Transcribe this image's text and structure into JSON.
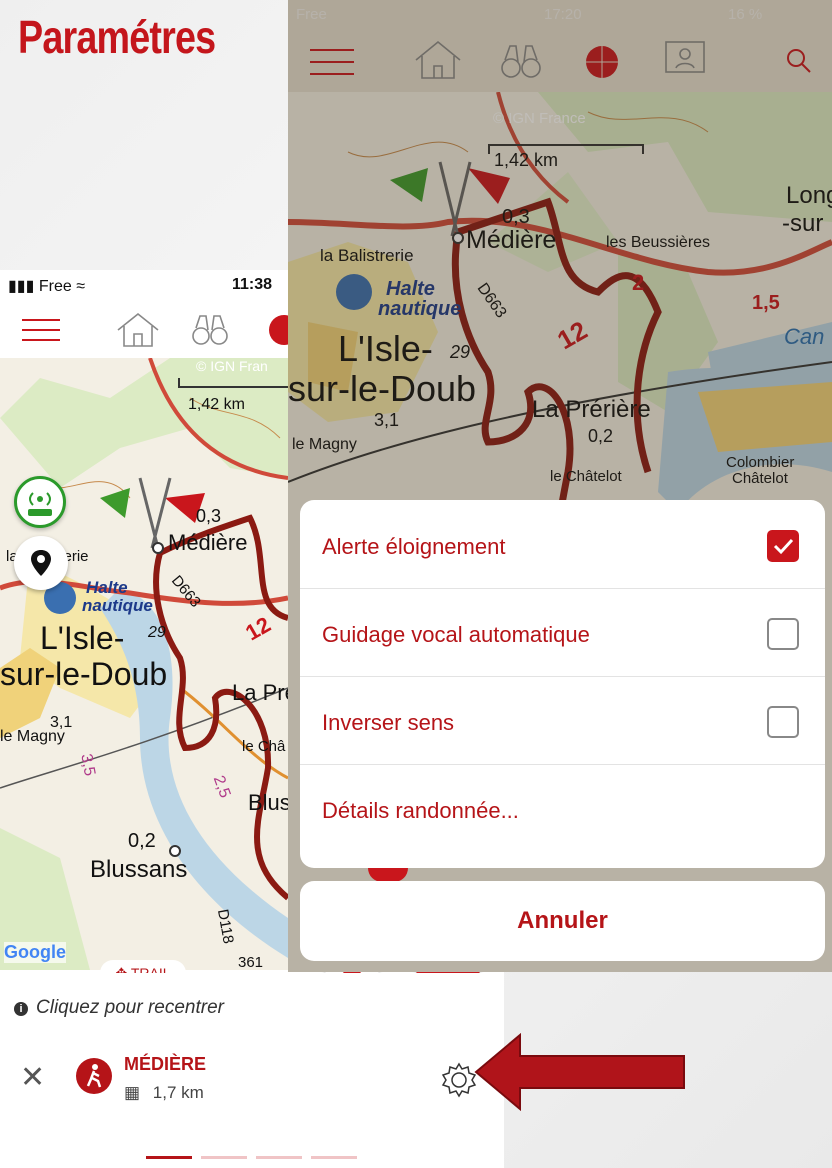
{
  "title": "Paramétres",
  "left_phone": {
    "status": {
      "carrier": "Free",
      "time": "11:38"
    },
    "map": {
      "attribution": "© IGN Fran",
      "scale": "1,42 km",
      "labels": {
        "mediere": "Médière",
        "mediere_dist": "0,3",
        "balistrerie": "la Balistrerie",
        "halte": "Halte",
        "nautique": "nautique",
        "isle": "L'Isle-",
        "doubs": "sur-le-Doub",
        "magny": "le Magny",
        "road": "D663",
        "d118": "D118",
        "blussans": "Blussans",
        "blussans_dist": "0,2",
        "prer": "La Pré",
        "chatelot": "le Châ",
        "blus": "Blus",
        "num_29": "29",
        "num_31": "3,1",
        "num_35": "3,5",
        "num_25": "2,5",
        "num_12": "12",
        "num_361": "361",
        "google": "Google"
      }
    },
    "trail_chip": "TRAIL",
    "go_label": "GO",
    "recenter_text": "Cliquez pour recentrer",
    "hike": {
      "name": "MÉDIÈRE",
      "distance": "1,7 km"
    },
    "pager_active": 0,
    "pager_count": 4
  },
  "right_phone": {
    "status": {
      "carrier": "Free",
      "time": "17:20",
      "battery": "16 %"
    },
    "map": {
      "attribution": "© IGN France",
      "scale": "1,42 km",
      "labels": {
        "mediere": "Médière",
        "mediere_dist": "0,3",
        "beussieres": "les Beussières",
        "balistrerie": "la Balistrerie",
        "halte": "Halte",
        "nautique": "nautique",
        "isle": "L'Isle-",
        "doubs": "sur-le-Doub",
        "magny": "le Magny",
        "road": "D663",
        "preriere": "La Prérière",
        "preriere_dist": "0,2",
        "chatelot": "le Châtelot",
        "colombier": "Colombier",
        "colombier2": "Châtelot",
        "long": "Long",
        "sur": "-sur",
        "can": "Can",
        "num_15": "1,5",
        "num_12": "12",
        "num_29": "29",
        "num_31": "3,1",
        "num_2": "2"
      }
    },
    "menu": {
      "items": [
        {
          "label": "Alerte éloignement",
          "checked": true
        },
        {
          "label": "Guidage vocal automatique",
          "checked": false
        },
        {
          "label": "Inverser sens",
          "checked": false
        },
        {
          "label": "Détails randonnée..."
        }
      ],
      "cancel": "Annuler"
    }
  },
  "colors": {
    "accent": "#c4161c",
    "map_bg": "#f3efe4",
    "route": "#8b1a12",
    "water": "#bcd6e6"
  }
}
